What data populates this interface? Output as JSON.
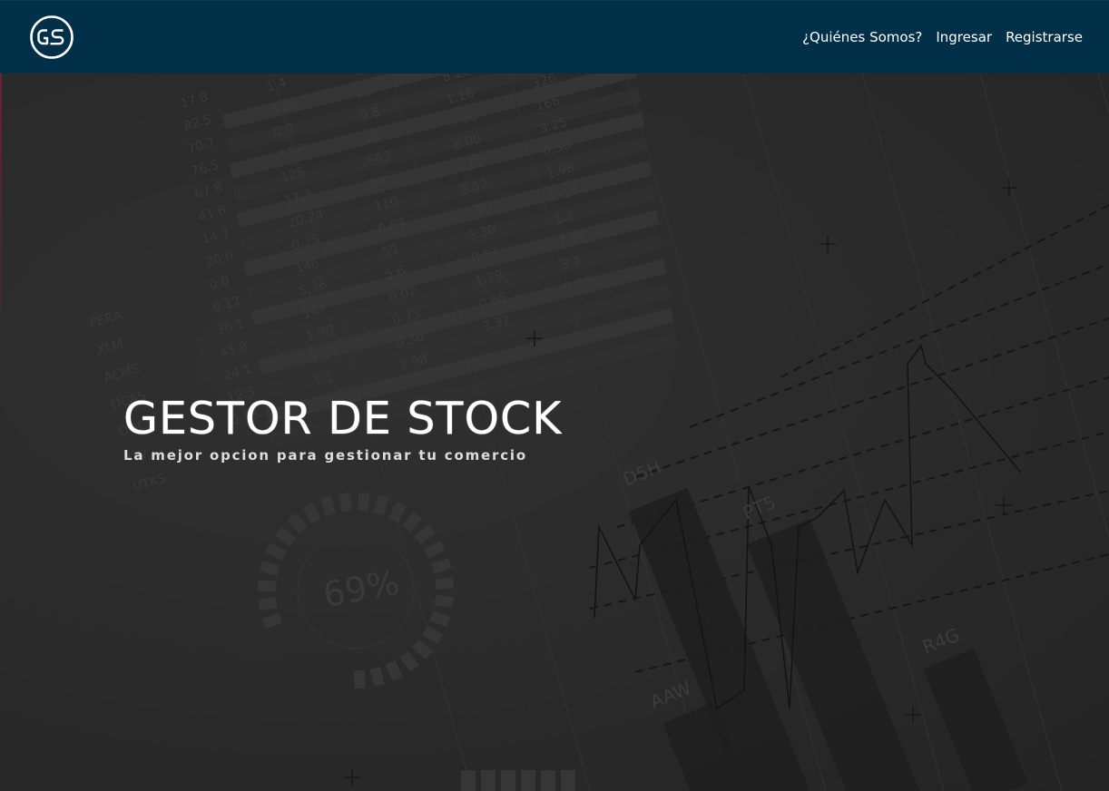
{
  "navbar": {
    "logo_text": "GS",
    "links": [
      "¿Quiénes Somos?",
      "Ingresar",
      "Registrarse"
    ]
  },
  "hero": {
    "title": "GESTOR DE STOCK",
    "subtitle": "La mejor opcion para gestionar tu comercio"
  },
  "background": {
    "gauge_label": "69%",
    "bar_labels": [
      "D5H",
      "PT5",
      "AAW",
      "R4G"
    ],
    "table_rows": [
      [
        "17.8",
        "1.4",
        "0.00",
        "8.23",
        "18.1"
      ],
      [
        "82.5",
        "3.84",
        "25",
        "8.20",
        "3.3"
      ],
      [
        "70.7",
        "0.0",
        "9.8",
        "1.16",
        "326"
      ],
      [
        "76.5",
        "4.58",
        "13",
        "3.36",
        "166"
      ],
      [
        "67.8",
        "125",
        "563",
        "6.00",
        "3.25"
      ],
      [
        "41.6",
        "17.8",
        "66",
        "0.67",
        "0.50"
      ],
      [
        "14.7",
        "20.24",
        "110",
        "3.52",
        "1.98"
      ],
      [
        "20.0",
        "0.25",
        "0.63",
        "1.50",
        "2.16"
      ],
      [
        "0.0",
        "146",
        "50",
        "3.30",
        "1.2"
      ],
      [
        "0.12",
        "5.36",
        "5.6",
        "0.53",
        "3.84"
      ],
      [
        "36.1",
        "147",
        "0.02",
        "1.29",
        "3.1"
      ],
      [
        "45.8",
        "1.98",
        "0.73",
        "0.65",
        "2.65"
      ],
      [
        "24.1",
        "3.54",
        "0.36",
        "3.37",
        ""
      ],
      [
        "12.3",
        "1.1",
        "2.98",
        "",
        ""
      ],
      [
        "0.18",
        "",
        "",
        "",
        ""
      ]
    ],
    "row_names": [
      "PERA",
      "XLM",
      "ACMS",
      "OCAS",
      "OOCS",
      "TLV",
      "UTKS"
    ],
    "colors": {
      "navbar": "#033049",
      "page": "#2a2a2a",
      "art": "#343434"
    }
  }
}
